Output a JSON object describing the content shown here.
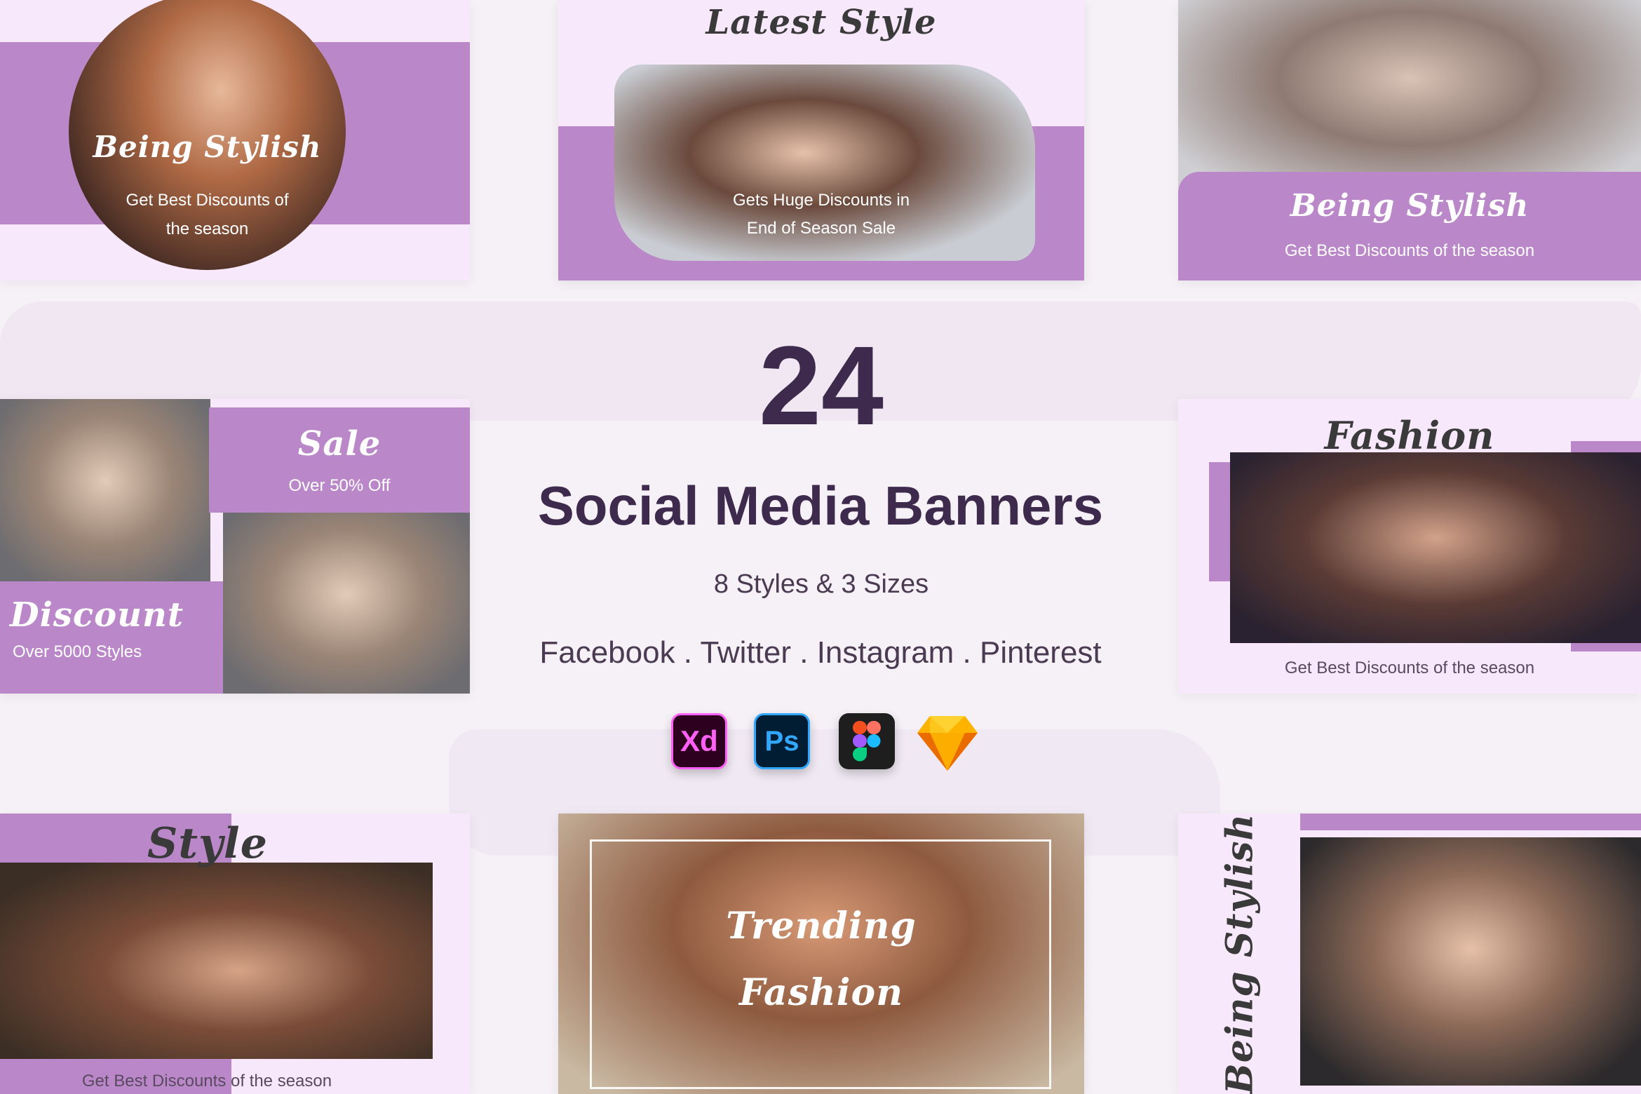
{
  "colors": {
    "background": "#f6f1f7",
    "purple": "#ba88c9",
    "light_pink": "#f8e8fb",
    "headline": "#3e2a4c",
    "text": "#4a3a52"
  },
  "hero": {
    "count": "24",
    "title": "Social Media Banners",
    "subtitle": "8 Styles & 3 Sizes",
    "platforms": "Facebook . Twitter . Instagram . Pinterest"
  },
  "tools": [
    {
      "name": "xd-icon",
      "label": "Xd",
      "bg": "#2e001f",
      "fg": "#ff61f6"
    },
    {
      "name": "photoshop-icon",
      "label": "Ps",
      "bg": "#001d34",
      "fg": "#31a8ff"
    },
    {
      "name": "figma-icon",
      "label": "",
      "bg": "#1e1e1e",
      "fg": "#ffffff"
    },
    {
      "name": "sketch-icon",
      "label": "",
      "bg": "#fdb300",
      "fg": "#ea6c00"
    }
  ],
  "banners": {
    "b1": {
      "title": "Being Stylish",
      "line1": "Get Best Discounts of",
      "line2": "the season"
    },
    "b2": {
      "title": "Latest Style",
      "line1": "Gets Huge Discounts in",
      "line2": "End of Season Sale"
    },
    "b3": {
      "title": "Being Stylish",
      "line1": "Get Best Discounts of the season"
    },
    "b4": {
      "title_top": "Sale",
      "sub_top": "Over 50% Off",
      "title_bottom": "Discount",
      "sub_bottom": "Over 5000 Styles"
    },
    "b5": {
      "title": "Fashion",
      "line1": "Get Best Discounts of the season"
    },
    "b6": {
      "title": "Style",
      "line1": "Get Best Discounts of the season"
    },
    "b7": {
      "line1": "Trending",
      "line2": "Fashion"
    },
    "b8": {
      "title": "Being Stylish"
    }
  }
}
